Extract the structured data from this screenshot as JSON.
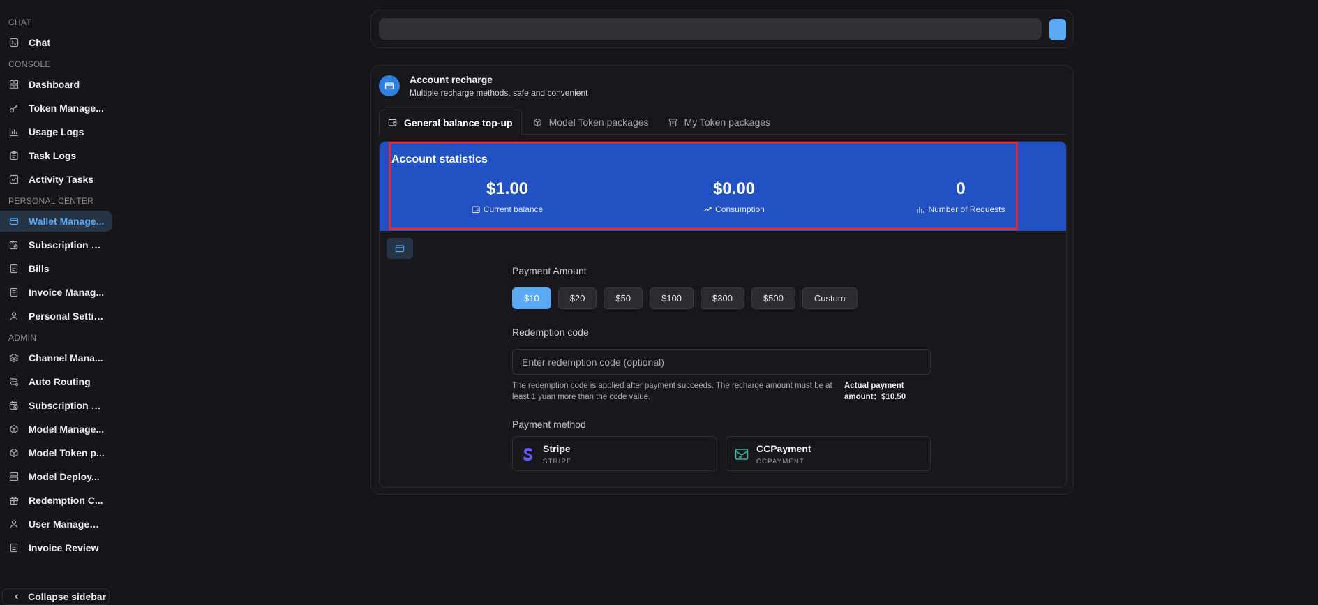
{
  "sidebar": {
    "sections": [
      {
        "title": "CHAT",
        "items": [
          {
            "label": "Chat",
            "icon": "chat-icon"
          }
        ]
      },
      {
        "title": "CONSOLE",
        "items": [
          {
            "label": "Dashboard",
            "icon": "dashboard-icon"
          },
          {
            "label": "Token Manage...",
            "icon": "key-icon"
          },
          {
            "label": "Usage Logs",
            "icon": "bar-chart-icon"
          },
          {
            "label": "Task Logs",
            "icon": "clipboard-icon"
          },
          {
            "label": "Activity Tasks",
            "icon": "checklist-icon"
          }
        ]
      },
      {
        "title": "PERSONAL CENTER",
        "items": [
          {
            "label": "Wallet Manage...",
            "icon": "wallet-icon",
            "active": true
          },
          {
            "label": "Subscription Pl...",
            "icon": "calendar-clock-icon"
          },
          {
            "label": "Bills",
            "icon": "document-icon"
          },
          {
            "label": "Invoice Manag...",
            "icon": "invoice-icon"
          },
          {
            "label": "Personal Settin...",
            "icon": "user-icon"
          }
        ]
      },
      {
        "title": "ADMIN",
        "items": [
          {
            "label": "Channel Mana...",
            "icon": "layers-icon"
          },
          {
            "label": "Auto Routing",
            "icon": "routing-icon"
          },
          {
            "label": "Subscription M...",
            "icon": "calendar-clock-icon"
          },
          {
            "label": "Model Manage...",
            "icon": "cube-icon"
          },
          {
            "label": "Model Token p...",
            "icon": "cube-icon"
          },
          {
            "label": "Model Deploy...",
            "icon": "server-icon"
          },
          {
            "label": "Redemption C...",
            "icon": "gift-icon"
          },
          {
            "label": "User Managem...",
            "icon": "user-icon"
          },
          {
            "label": "Invoice Review",
            "icon": "invoice-icon"
          }
        ]
      }
    ],
    "collapse_label": "Collapse sidebar"
  },
  "search": {
    "placeholder": ""
  },
  "recharge": {
    "title": "Account recharge",
    "subtitle": "Multiple recharge methods, safe and convenient",
    "tabs": [
      {
        "label": "General balance top-up",
        "icon": "wallet-icon",
        "active": true
      },
      {
        "label": "Model Token packages",
        "icon": "cube-icon"
      },
      {
        "label": "My Token packages",
        "icon": "package-icon"
      }
    ],
    "stats": {
      "title": "Account statistics",
      "balance": {
        "value": "$1.00",
        "label": "Current balance"
      },
      "consumption": {
        "value": "$0.00",
        "label": "Consumption"
      },
      "requests": {
        "value": "0",
        "label": "Number of Requests"
      }
    },
    "payment_amount_label": "Payment Amount",
    "amounts": [
      "$10",
      "$20",
      "$50",
      "$100",
      "$300",
      "$500",
      "Custom"
    ],
    "selected_amount": "$10",
    "redemption_label": "Redemption code",
    "redemption_placeholder": "Enter redemption code (optional)",
    "redemption_hint": "The redemption code is applied after payment succeeds. The recharge amount must be at least 1 yuan more than the code value.",
    "actual_payment_label": "Actual payment amount：",
    "actual_payment_value": "$10.50",
    "payment_method_label": "Payment method",
    "payment_methods": [
      {
        "name": "Stripe",
        "code": "STRIPE",
        "color": "#635bff"
      },
      {
        "name": "CCPayment",
        "code": "CCPAYMENT",
        "color": "#2fb4a6"
      }
    ]
  },
  "colors": {
    "accent": "#5aa9f5",
    "stats_band": "#2151c3",
    "highlight_border": "#d92b3a",
    "background": "#16161a"
  }
}
